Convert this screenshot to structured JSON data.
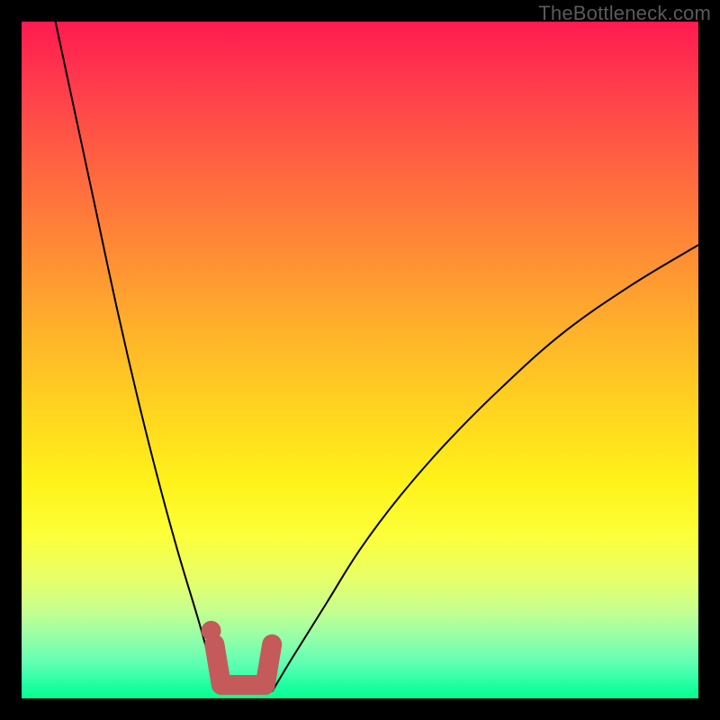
{
  "watermark": "TheBottleneck.com",
  "colors": {
    "frame_border": "#000000",
    "curve": "#000000",
    "marker": "#c45a5a",
    "gradient_top": "#ff1a50",
    "gradient_bottom": "#07ff92"
  },
  "chart_data": {
    "type": "line",
    "title": "",
    "xlabel": "",
    "ylabel": "",
    "xlim": [
      0,
      100
    ],
    "ylim": [
      0,
      100
    ],
    "series": [
      {
        "name": "left-curve",
        "x": [
          5,
          8,
          11,
          14,
          17,
          20,
          23,
          26,
          28,
          29.5
        ],
        "y": [
          100,
          86,
          72,
          58,
          45,
          33,
          22,
          12,
          5,
          1
        ]
      },
      {
        "name": "right-curve",
        "x": [
          37,
          40,
          45,
          50,
          56,
          63,
          71,
          80,
          90,
          100
        ],
        "y": [
          1,
          6,
          14,
          22,
          30,
          38,
          46,
          54,
          61,
          67
        ]
      }
    ],
    "marker": {
      "name": "u-marker",
      "note": "salmon U-shaped highlight near curve minimum",
      "dot": {
        "x": 28,
        "y": 10
      },
      "path": [
        {
          "x": 28.5,
          "y": 8
        },
        {
          "x": 29.5,
          "y": 2
        },
        {
          "x": 36,
          "y": 2
        },
        {
          "x": 37,
          "y": 8
        }
      ]
    }
  }
}
